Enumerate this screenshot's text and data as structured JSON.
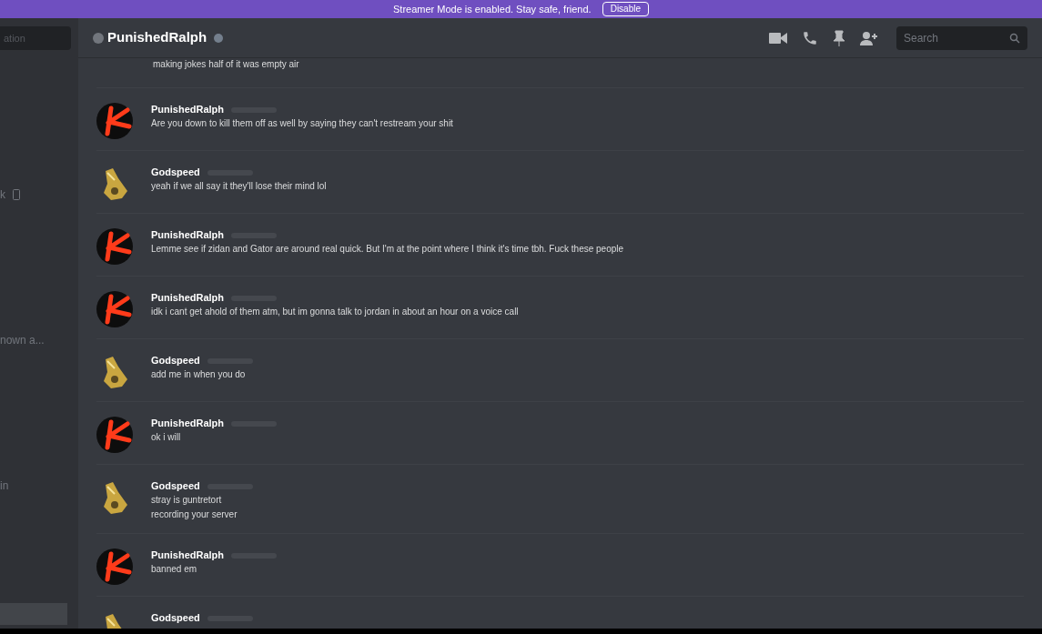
{
  "banner": {
    "text": "Streamer Mode is enabled. Stay safe, friend.",
    "button": "Disable"
  },
  "sidebar": {
    "search_placeholder": "ation",
    "items": [
      {
        "label": "k",
        "mobile": true
      },
      {
        "label": "nown a...",
        "mobile": false
      },
      {
        "label": "in",
        "mobile": false
      }
    ]
  },
  "header": {
    "title": "PunishedRalph",
    "online": false,
    "search_placeholder": "Search"
  },
  "messages": [
    {
      "kind": "continuation",
      "lines": [
        "making jokes half of it was empty air"
      ]
    },
    {
      "kind": "group",
      "avatar": {
        "kind": "red-k"
      },
      "author": "PunishedRalph",
      "lines": [
        "Are you down to kill them off as well by saying they can't restream your shit"
      ]
    },
    {
      "kind": "group",
      "avatar": {
        "kind": "gold-mask"
      },
      "author": "Godspeed",
      "lines": [
        "yeah if we all say it they'll lose their mind lol"
      ]
    },
    {
      "kind": "group",
      "avatar": {
        "kind": "red-k"
      },
      "author": "PunishedRalph",
      "lines": [
        "Lemme see if zidan and Gator are around real quick. But I'm at the point where I think it's time tbh. Fuck these people"
      ]
    },
    {
      "kind": "group",
      "avatar": {
        "kind": "red-k"
      },
      "author": "PunishedRalph",
      "lines": [
        "idk i cant get ahold of them atm, but im gonna talk to jordan in about an hour on a voice call"
      ]
    },
    {
      "kind": "group",
      "avatar": {
        "kind": "gold-mask"
      },
      "author": "Godspeed",
      "lines": [
        "add me in when you do"
      ]
    },
    {
      "kind": "group",
      "avatar": {
        "kind": "red-k"
      },
      "author": "PunishedRalph",
      "lines": [
        "ok i will"
      ]
    },
    {
      "kind": "group",
      "avatar": {
        "kind": "gold-mask"
      },
      "author": "Godspeed",
      "lines": [
        "stray is guntretort",
        "recording your server"
      ]
    },
    {
      "kind": "group",
      "avatar": {
        "kind": "red-k"
      },
      "author": "PunishedRalph",
      "lines": [
        "banned em"
      ]
    },
    {
      "kind": "group",
      "avatar": {
        "kind": "gold-mask"
      },
      "author": "Godspeed"
    }
  ]
}
